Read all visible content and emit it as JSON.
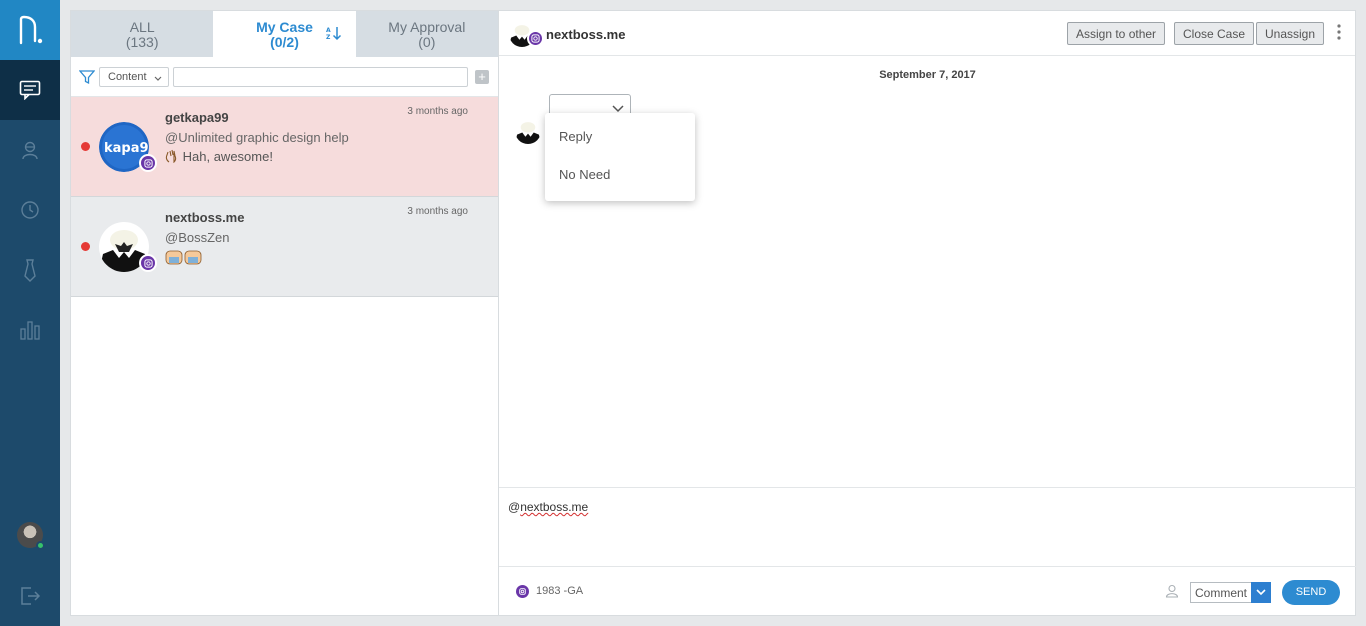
{
  "rail": {
    "items": [
      {
        "name": "conversations-icon",
        "active": true
      },
      {
        "name": "contacts-icon",
        "active": false
      },
      {
        "name": "history-icon",
        "active": false
      },
      {
        "name": "tie-icon",
        "active": false
      },
      {
        "name": "reports-icon",
        "active": false
      }
    ]
  },
  "tabs": [
    {
      "label": "ALL",
      "count": "(133)"
    },
    {
      "label": "My Case",
      "count": "(0/2)"
    },
    {
      "label": "My Approval",
      "count": "(0)"
    }
  ],
  "filter": {
    "content_label": "Content",
    "search_value": ""
  },
  "cases": [
    {
      "name": "getkapa99",
      "handle": "@Unlimited graphic design help",
      "message": "Hah, awesome!",
      "time": "3 months ago",
      "avatar_text": "kapa99"
    },
    {
      "name": "nextboss.me",
      "handle": "@BossZen",
      "message": "",
      "time": "3 months ago"
    }
  ],
  "chat": {
    "title": "nextboss.me",
    "buttons": {
      "assign": "Assign to other",
      "close": "Close Case",
      "unassign": "Unassign"
    },
    "date": "September 7, 2017",
    "dropdown": [
      "Reply",
      "No Need"
    ],
    "composer_prefix": "@",
    "composer_mention": "nextboss.me",
    "account": "1983 -GA",
    "comment_type": "Comment",
    "send_label": "SEND"
  },
  "colors": {
    "rail": "#1d4a6b",
    "accent": "#2d8bd1",
    "instagram": "#6a36a8",
    "unread": "#e53935"
  }
}
